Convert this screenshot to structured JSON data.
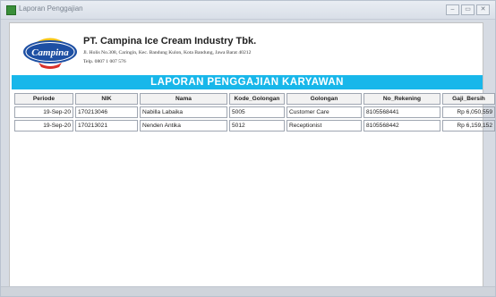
{
  "window": {
    "title": "Laporan Penggajian"
  },
  "header": {
    "logo_text": "Campina",
    "company": "PT. Campina Ice Cream Industry Tbk.",
    "address": "Jl. Holis No.308, Caringin, Kec. Bandung Kulon, Kota Bandung, Jawa Barat 40212",
    "phone": "Telp. 0807 1 007 576"
  },
  "report": {
    "title": "LAPORAN PENGGAJIAN KARYAWAN",
    "columns": [
      "Periode",
      "NIK",
      "Nama",
      "Kode_Golongan",
      "Golongan",
      "No_Rekening",
      "Gaji_Bersih"
    ],
    "rows": [
      [
        "19-Sep-20",
        "170213046",
        "Nabilla Labaika",
        "5005",
        "Customer Care",
        "8105568441",
        "Rp 6,050,559"
      ],
      [
        "19-Sep-20",
        "170213021",
        "Nenden Antika",
        "5012",
        "Receptionist",
        "8105568442",
        "Rp 6,159,152"
      ]
    ]
  },
  "colors": {
    "banner": "#18b7ea",
    "logo_blue": "#1d4fa3",
    "logo_red": "#d9302a",
    "logo_yellow": "#f6c61a"
  }
}
